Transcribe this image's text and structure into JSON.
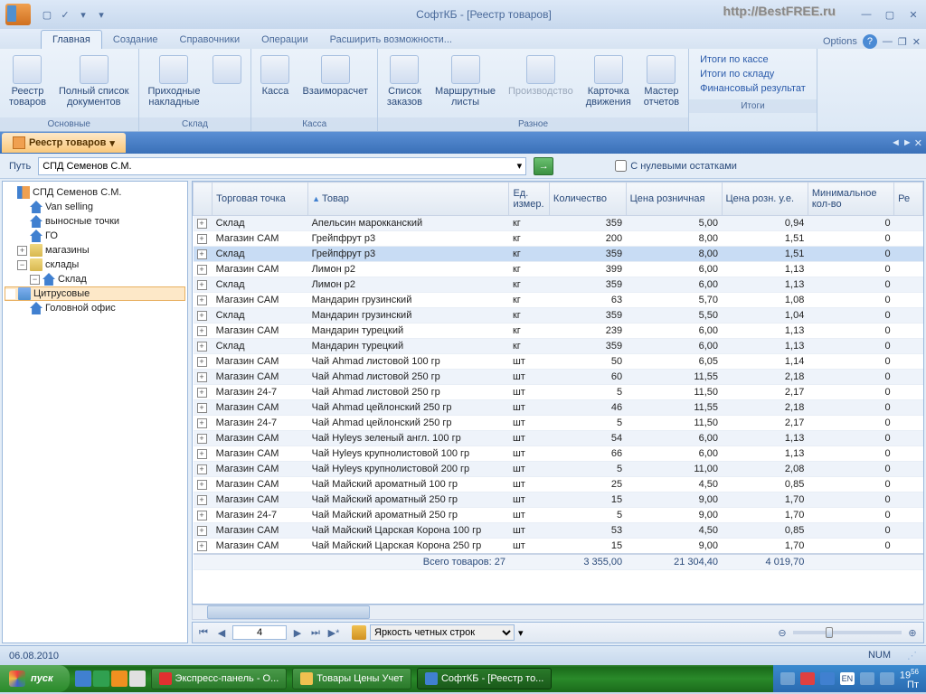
{
  "title": "СофтКБ - [Реестр товаров]",
  "watermark": "http://BestFREE.ru",
  "ribbon_tabs": [
    "Главная",
    "Создание",
    "Справочники",
    "Операции",
    "Расширить возможности..."
  ],
  "options_label": "Options",
  "ribbon": {
    "groups": [
      {
        "label": "Основные",
        "buttons": [
          {
            "label": "Реестр\nтоваров"
          },
          {
            "label": "Полный список\nдокументов"
          }
        ]
      },
      {
        "label": "Склад",
        "buttons": [
          {
            "label": "Приходные\nнакладные"
          },
          {
            "label": ""
          }
        ]
      },
      {
        "label": "Касса",
        "buttons": [
          {
            "label": "Касса"
          },
          {
            "label": "Взаиморасчет"
          }
        ]
      },
      {
        "label": "Разное",
        "buttons": [
          {
            "label": "Список\nзаказов"
          },
          {
            "label": "Маршрутные\nлисты"
          },
          {
            "label": "Производство",
            "disabled": true
          },
          {
            "label": "Карточка\nдвижения"
          },
          {
            "label": "Мастер\nотчетов"
          }
        ]
      }
    ],
    "links_group": "Итоги",
    "links": [
      "Итоги по кассе",
      "Итоги по складу",
      "Финансовый результат"
    ]
  },
  "doc_tab": "Реестр товаров",
  "path_label": "Путь",
  "path_value": "СПД Семенов С.М.",
  "zero_stock": "С нулевыми остатками",
  "tree": [
    {
      "ind": 0,
      "tog": "",
      "icon": "ti-chart",
      "label": "СПД Семенов С.М."
    },
    {
      "ind": 1,
      "tog": " ",
      "icon": "ti-house",
      "label": "Van selling"
    },
    {
      "ind": 1,
      "tog": " ",
      "icon": "ti-house",
      "label": "выносные точки"
    },
    {
      "ind": 1,
      "tog": " ",
      "icon": "ti-house",
      "label": "ГО"
    },
    {
      "ind": 1,
      "tog": "+",
      "icon": "ti-folder",
      "label": "магазины"
    },
    {
      "ind": 1,
      "tog": "−",
      "icon": "ti-folder",
      "label": "склады"
    },
    {
      "ind": 2,
      "tog": "−",
      "icon": "ti-house",
      "label": "Склад"
    },
    {
      "ind": 3,
      "tog": " ",
      "icon": "ti-folder-blue",
      "label": "Цитрусовые",
      "sel": true
    },
    {
      "ind": 1,
      "tog": " ",
      "icon": "ti-house",
      "label": "Головной офис"
    }
  ],
  "columns": [
    "",
    "Торговая точка",
    "Товар",
    "Ед.\nизмер.",
    "Количество",
    "Цена розничная",
    "Цена розн. у.е.",
    "Минимальное\nкол-во",
    "Ре"
  ],
  "rows": [
    {
      "pt": "Склад",
      "name": "Апельсин марокканский",
      "unit": "кг",
      "qty": "359",
      "price": "5,00",
      "usd": "0,94",
      "min": "0"
    },
    {
      "pt": "Магазин САМ",
      "name": "Грейпфрут р3",
      "unit": "кг",
      "qty": "200",
      "price": "8,00",
      "usd": "1,51",
      "min": "0"
    },
    {
      "pt": "Склад",
      "name": "Грейпфрут р3",
      "unit": "кг",
      "qty": "359",
      "price": "8,00",
      "usd": "1,51",
      "min": "0",
      "sel": true
    },
    {
      "pt": "Магазин САМ",
      "name": "Лимон р2",
      "unit": "кг",
      "qty": "399",
      "price": "6,00",
      "usd": "1,13",
      "min": "0"
    },
    {
      "pt": "Склад",
      "name": "Лимон р2",
      "unit": "кг",
      "qty": "359",
      "price": "6,00",
      "usd": "1,13",
      "min": "0"
    },
    {
      "pt": "Магазин САМ",
      "name": "Мандарин грузинский",
      "unit": "кг",
      "qty": "63",
      "price": "5,70",
      "usd": "1,08",
      "min": "0"
    },
    {
      "pt": "Склад",
      "name": "Мандарин грузинский",
      "unit": "кг",
      "qty": "359",
      "price": "5,50",
      "usd": "1,04",
      "min": "0"
    },
    {
      "pt": "Магазин САМ",
      "name": "Мандарин турецкий",
      "unit": "кг",
      "qty": "239",
      "price": "6,00",
      "usd": "1,13",
      "min": "0"
    },
    {
      "pt": "Склад",
      "name": "Мандарин турецкий",
      "unit": "кг",
      "qty": "359",
      "price": "6,00",
      "usd": "1,13",
      "min": "0"
    },
    {
      "pt": "Магазин САМ",
      "name": "Чай Ahmad листовой 100 гр",
      "unit": "шт",
      "qty": "50",
      "price": "6,05",
      "usd": "1,14",
      "min": "0"
    },
    {
      "pt": "Магазин САМ",
      "name": "Чай Ahmad листовой 250 гр",
      "unit": "шт",
      "qty": "60",
      "price": "11,55",
      "usd": "2,18",
      "min": "0"
    },
    {
      "pt": "Магазин 24-7",
      "name": "Чай Ahmad листовой 250 гр",
      "unit": "шт",
      "qty": "5",
      "price": "11,50",
      "usd": "2,17",
      "min": "0"
    },
    {
      "pt": "Магазин САМ",
      "name": "Чай Ahmad цейлонский 250 гр",
      "unit": "шт",
      "qty": "46",
      "price": "11,55",
      "usd": "2,18",
      "min": "0"
    },
    {
      "pt": "Магазин 24-7",
      "name": "Чай Ahmad цейлонский 250 гр",
      "unit": "шт",
      "qty": "5",
      "price": "11,50",
      "usd": "2,17",
      "min": "0"
    },
    {
      "pt": "Магазин САМ",
      "name": "Чай Hyleys зеленый англ. 100 гр",
      "unit": "шт",
      "qty": "54",
      "price": "6,00",
      "usd": "1,13",
      "min": "0"
    },
    {
      "pt": "Магазин САМ",
      "name": "Чай Hyleys крупнолистовой 100 гр",
      "unit": "шт",
      "qty": "66",
      "price": "6,00",
      "usd": "1,13",
      "min": "0"
    },
    {
      "pt": "Магазин САМ",
      "name": "Чай Hyleys крупнолистовой 200 гр",
      "unit": "шт",
      "qty": "5",
      "price": "11,00",
      "usd": "2,08",
      "min": "0"
    },
    {
      "pt": "Магазин САМ",
      "name": "Чай Майский ароматный 100 гр",
      "unit": "шт",
      "qty": "25",
      "price": "4,50",
      "usd": "0,85",
      "min": "0"
    },
    {
      "pt": "Магазин САМ",
      "name": "Чай Майский ароматный 250 гр",
      "unit": "шт",
      "qty": "15",
      "price": "9,00",
      "usd": "1,70",
      "min": "0"
    },
    {
      "pt": "Магазин 24-7",
      "name": "Чай Майский ароматный 250 гр",
      "unit": "шт",
      "qty": "5",
      "price": "9,00",
      "usd": "1,70",
      "min": "0"
    },
    {
      "pt": "Магазин САМ",
      "name": "Чай Майский Царская Корона 100 гр",
      "unit": "шт",
      "qty": "53",
      "price": "4,50",
      "usd": "0,85",
      "min": "0"
    },
    {
      "pt": "Магазин САМ",
      "name": "Чай Майский Царская Корона 250 гр",
      "unit": "шт",
      "qty": "15",
      "price": "9,00",
      "usd": "1,70",
      "min": "0"
    }
  ],
  "footer": {
    "label": "Всего товаров: 27",
    "qty": "3 355,00",
    "price": "21 304,40",
    "usd": "4 019,70"
  },
  "nav_page": "4",
  "brightness_label": "Яркость четных строк",
  "status_date": "06.08.2010",
  "status_num": "NUM",
  "taskbar": {
    "start": "пуск",
    "items": [
      {
        "label": "Экспресс-панель - O...",
        "icon": "#e03030"
      },
      {
        "label": "Товары Цены Учет",
        "icon": "#f0c050"
      },
      {
        "label": "СофтКБ - [Реестр то...",
        "icon": "#4080d0",
        "active": true
      }
    ],
    "time": "19",
    "min": "56",
    "day": "Пт"
  }
}
